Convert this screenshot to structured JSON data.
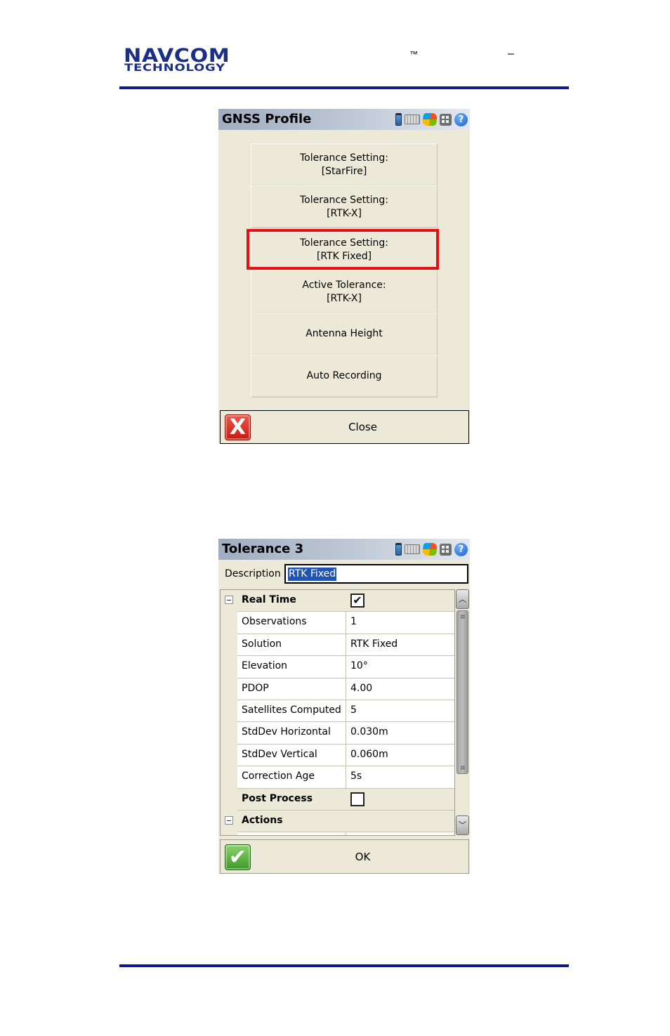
{
  "header": {
    "logo_line1": "NAVCOM",
    "logo_line2": "TECHNOLOGY",
    "trademark": "™",
    "dash": "–",
    "brand_color": "#1c2f86",
    "rule_color": "#0f1a8c"
  },
  "gnss_profile": {
    "title": "GNSS Profile",
    "tray_icons": [
      "battery-icon",
      "keyboard-icon",
      "windows-start-icon",
      "apps-icon",
      "help-icon"
    ],
    "help_glyph": "?",
    "menu_items": [
      {
        "line1": "Tolerance Setting:",
        "line2": "[StarFire]"
      },
      {
        "line1": "Tolerance Setting:",
        "line2": "[RTK-X]"
      },
      {
        "line1": "Tolerance Setting:",
        "line2": "[RTK Fixed]",
        "highlighted": true
      },
      {
        "line1": "Active Tolerance:",
        "line2": "[RTK-X]"
      },
      {
        "line1": "Antenna Height",
        "line2": ""
      },
      {
        "line1": "Auto Recording",
        "line2": ""
      }
    ],
    "highlight_color": "#e41016",
    "close_icon_glyph": "X",
    "close_label": "Close"
  },
  "tolerance": {
    "title": "Tolerance 3",
    "help_glyph": "?",
    "description_label": "Description",
    "description_value": "RTK Fixed",
    "groups": {
      "real_time": {
        "label": "Real Time",
        "checked": true,
        "check_glyph": "✔"
      },
      "post_process": {
        "label": "Post Process",
        "checked": false,
        "check_glyph": ""
      },
      "actions": {
        "label": "Actions"
      }
    },
    "rows": [
      {
        "key": "Observations",
        "value": "1"
      },
      {
        "key": "Solution",
        "value": "RTK Fixed"
      },
      {
        "key": "Elevation",
        "value": "10°"
      },
      {
        "key": "PDOP",
        "value": "4.00"
      },
      {
        "key": "Satellites Computed",
        "value": "5"
      },
      {
        "key": "StdDev Horizontal",
        "value": "0.030m"
      },
      {
        "key": "StdDev Vertical",
        "value": "0.060m"
      },
      {
        "key": "Correction Age",
        "value": "5s"
      }
    ],
    "ok_icon_glyph": "✔",
    "ok_label": "OK"
  }
}
